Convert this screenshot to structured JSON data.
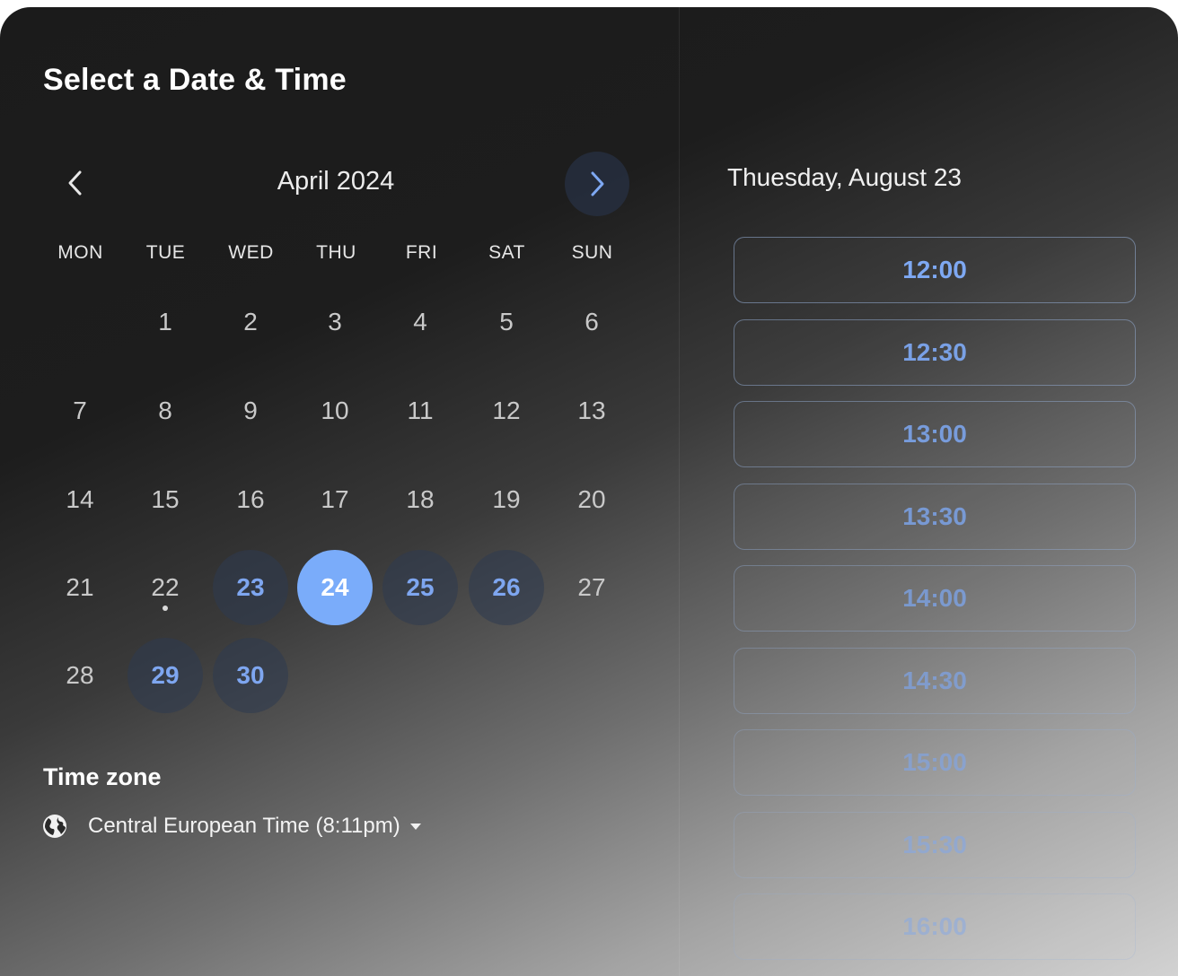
{
  "title": "Select a Date & Time",
  "calendar": {
    "month_label": "April 2024",
    "prev_icon": "chevron-left-icon",
    "next_icon": "chevron-right-icon",
    "weekdays": [
      "MON",
      "TUE",
      "WED",
      "THU",
      "FRI",
      "SAT",
      "SUN"
    ],
    "weeks": [
      [
        null,
        "1",
        "2",
        "3",
        "4",
        "5",
        "6"
      ],
      [
        "7",
        "8",
        "9",
        "10",
        "11",
        "12",
        "13"
      ],
      [
        "14",
        "15",
        "16",
        "17",
        "18",
        "19",
        "20"
      ],
      [
        "21",
        "22",
        "23",
        "24",
        "25",
        "26",
        "27"
      ],
      [
        "28",
        "29",
        "30",
        null,
        null,
        null,
        null
      ]
    ],
    "available_days": [
      "23",
      "25",
      "26",
      "29",
      "30"
    ],
    "selected_day": "24",
    "today_day": "22",
    "colors": {
      "accent": "#7aacfa",
      "available_text": "#7ea6f0"
    }
  },
  "timezone": {
    "label": "Time zone",
    "value": "Central European Time (8:11pm)",
    "icon": "globe-icon",
    "caret_icon": "caret-down-icon"
  },
  "slots": {
    "date_label": "Thuesday, August 23",
    "times": [
      "12:00",
      "12:30",
      "13:00",
      "13:30",
      "14:00",
      "14:30",
      "15:00",
      "15:30",
      "16:00"
    ]
  }
}
